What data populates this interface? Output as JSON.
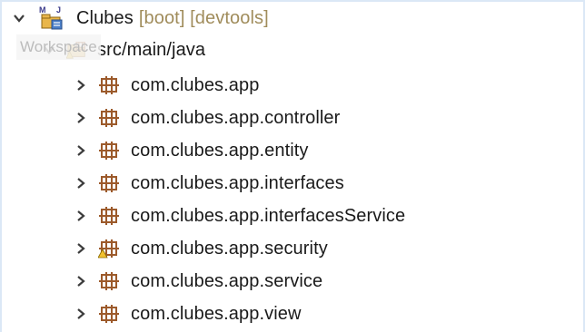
{
  "project": {
    "name": "Clubes",
    "decorations": "[boot] [devtools]",
    "project_badge": "M",
    "project_badge_2": "J"
  },
  "tooltip": "Workspace",
  "source_folder": {
    "label": "src/main/java"
  },
  "packages": [
    {
      "label": "com.clubes.app",
      "warning": false
    },
    {
      "label": "com.clubes.app.controller",
      "warning": false
    },
    {
      "label": "com.clubes.app.entity",
      "warning": false
    },
    {
      "label": "com.clubes.app.interfaces",
      "warning": false
    },
    {
      "label": "com.clubes.app.interfacesService",
      "warning": false
    },
    {
      "label": "com.clubes.app.security",
      "warning": true
    },
    {
      "label": "com.clubes.app.service",
      "warning": false
    },
    {
      "label": "com.clubes.app.view",
      "warning": false
    }
  ],
  "colors": {
    "package_icon": "#9c5a2b",
    "warning": "#f2c12e",
    "decoration_text": "#a08c5b",
    "arrow": "#3c3c3c"
  },
  "icons": {
    "expanded": "chevron-down-icon",
    "collapsed": "chevron-right-icon",
    "project": "java-project-icon",
    "source_folder": "source-folder-icon",
    "package": "package-icon",
    "warning": "warning-overlay-icon"
  }
}
